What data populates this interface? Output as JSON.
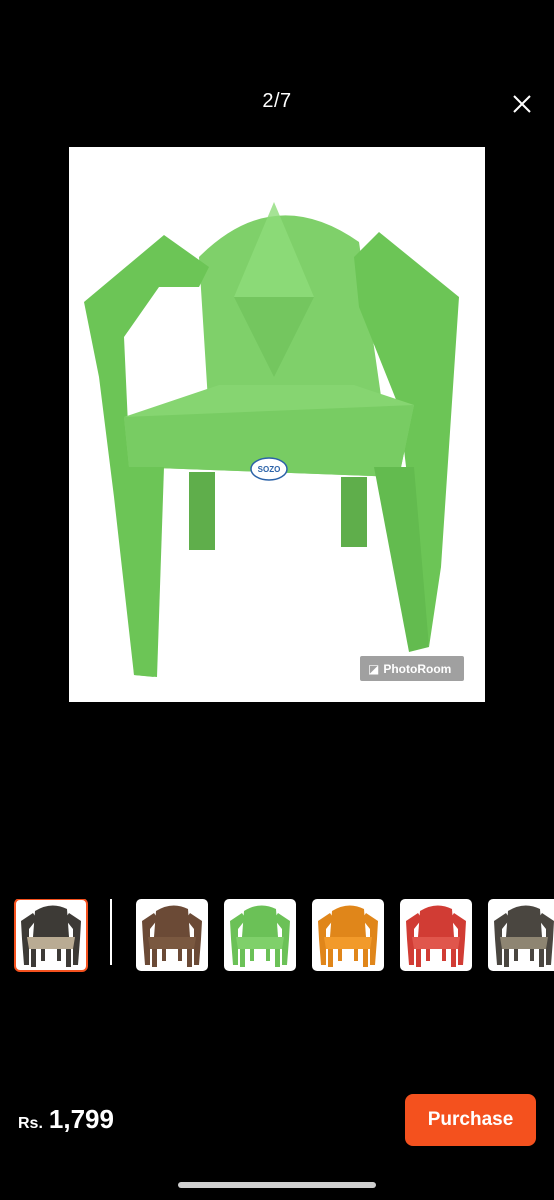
{
  "header": {
    "counter": "2/7",
    "close_icon": "close-icon"
  },
  "gallery": {
    "current_image": "green-chair",
    "watermark": "PhotoRoom",
    "chair_brand_label": "SOZO",
    "thumbnails": [
      {
        "color_name": "gray-beige",
        "color": "#3d3a36",
        "seat": "#b9ab93",
        "selected": true
      },
      {
        "color_name": "brown",
        "color": "#6b4a36",
        "seat": "#7a5840",
        "selected": false
      },
      {
        "color_name": "green",
        "color": "#6bc157",
        "seat": "#7fd06a",
        "selected": false
      },
      {
        "color_name": "orange",
        "color": "#e0861a",
        "seat": "#f29a2a",
        "selected": false
      },
      {
        "color_name": "red",
        "color": "#d13c34",
        "seat": "#e0564c",
        "selected": false
      },
      {
        "color_name": "dark-gray",
        "color": "#4a4640",
        "seat": "#8e8572",
        "selected": false
      }
    ]
  },
  "footer": {
    "currency": "Rs.",
    "price": "1,799",
    "purchase_label": "Purchase",
    "accent_color": "#f4511e"
  }
}
